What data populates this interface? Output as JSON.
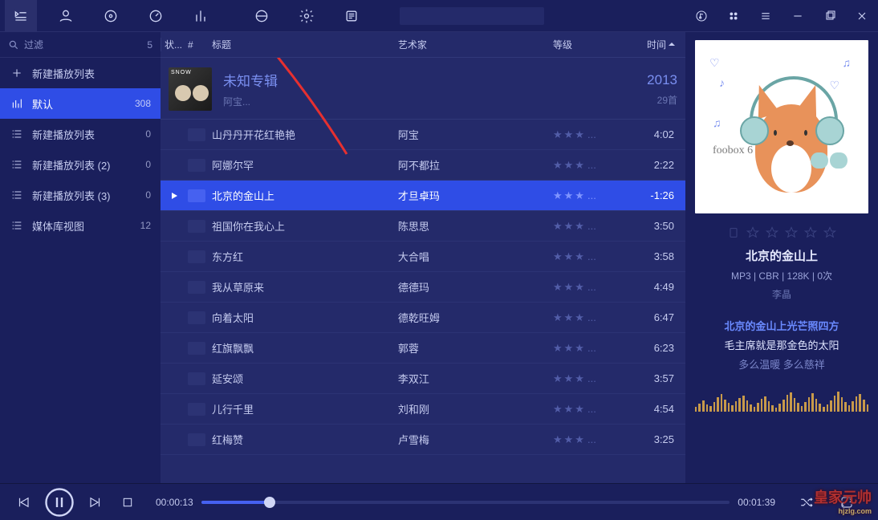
{
  "topbar": {
    "icons": [
      "playlist",
      "user",
      "disc",
      "gauge",
      "equalizer",
      "contrast",
      "settings",
      "text"
    ]
  },
  "winicons": [
    "music-circle",
    "grid",
    "menu",
    "minimize",
    "maximize",
    "close"
  ],
  "sidebar": {
    "search_placeholder": "过滤",
    "search_count": "5",
    "items": [
      {
        "icon": "plus",
        "label": "新建播放列表",
        "count": ""
      },
      {
        "icon": "bars",
        "label": "默认",
        "count": "308",
        "active": true
      },
      {
        "icon": "list",
        "label": "新建播放列表",
        "count": "0"
      },
      {
        "icon": "list",
        "label": "新建播放列表 (2)",
        "count": "0"
      },
      {
        "icon": "list",
        "label": "新建播放列表 (3)",
        "count": "0"
      },
      {
        "icon": "list",
        "label": "媒体库视图",
        "count": "12"
      }
    ]
  },
  "columns": {
    "status": "状...",
    "num": "#",
    "title": "标题",
    "artist": "艺术家",
    "rating": "等级",
    "time": "时间"
  },
  "album": {
    "title": "未知专辑",
    "sub": "阿宝...",
    "year": "2013",
    "count": "29首"
  },
  "tracks": [
    {
      "title": "山丹丹开花红艳艳",
      "artist": "阿宝",
      "time": "4:02"
    },
    {
      "title": "阿娜尔罕",
      "artist": "阿不都拉",
      "time": "2:22"
    },
    {
      "title": "北京的金山上",
      "artist": "才旦卓玛",
      "time": "-1:26",
      "active": true
    },
    {
      "title": "祖国你在我心上",
      "artist": "陈思思",
      "time": "3:50"
    },
    {
      "title": "东方红",
      "artist": "大合唱",
      "time": "3:58"
    },
    {
      "title": "我从草原来",
      "artist": "德德玛",
      "time": "4:49"
    },
    {
      "title": "向着太阳",
      "artist": "德乾旺姆",
      "time": "6:47"
    },
    {
      "title": "红旗飘飘",
      "artist": "郭蓉",
      "time": "6:23"
    },
    {
      "title": "延安颂",
      "artist": "李双江",
      "time": "3:57"
    },
    {
      "title": "儿行千里",
      "artist": "刘和刚",
      "time": "4:54"
    },
    {
      "title": "红梅赞",
      "artist": "卢雪梅",
      "time": "3:25"
    }
  ],
  "nowplaying": {
    "cover_label": "foobox 6",
    "title": "北京的金山上",
    "meta": "MP3 | CBR | 128K | 0次",
    "sub": "李晶",
    "lyrics": [
      {
        "t": "北京的金山上光芒照四方",
        "cls": "hl"
      },
      {
        "t": "毛主席就是那金色的太阳",
        "cls": ""
      },
      {
        "t": "多么温暖 多么慈祥",
        "cls": "dim"
      }
    ]
  },
  "player": {
    "elapsed": "00:00:13",
    "total": "00:01:39"
  },
  "watermark": {
    "txt": "皇家元帅",
    "url": "hjzlg.com"
  },
  "spectrum": [
    6,
    10,
    14,
    9,
    7,
    12,
    18,
    22,
    15,
    11,
    8,
    13,
    17,
    20,
    14,
    9,
    6,
    11,
    16,
    19,
    13,
    8,
    5,
    10,
    15,
    21,
    24,
    17,
    11,
    7,
    12,
    18,
    23,
    16,
    10,
    6,
    9,
    14,
    20,
    25,
    18,
    12,
    8,
    13,
    19,
    22,
    15,
    9
  ]
}
